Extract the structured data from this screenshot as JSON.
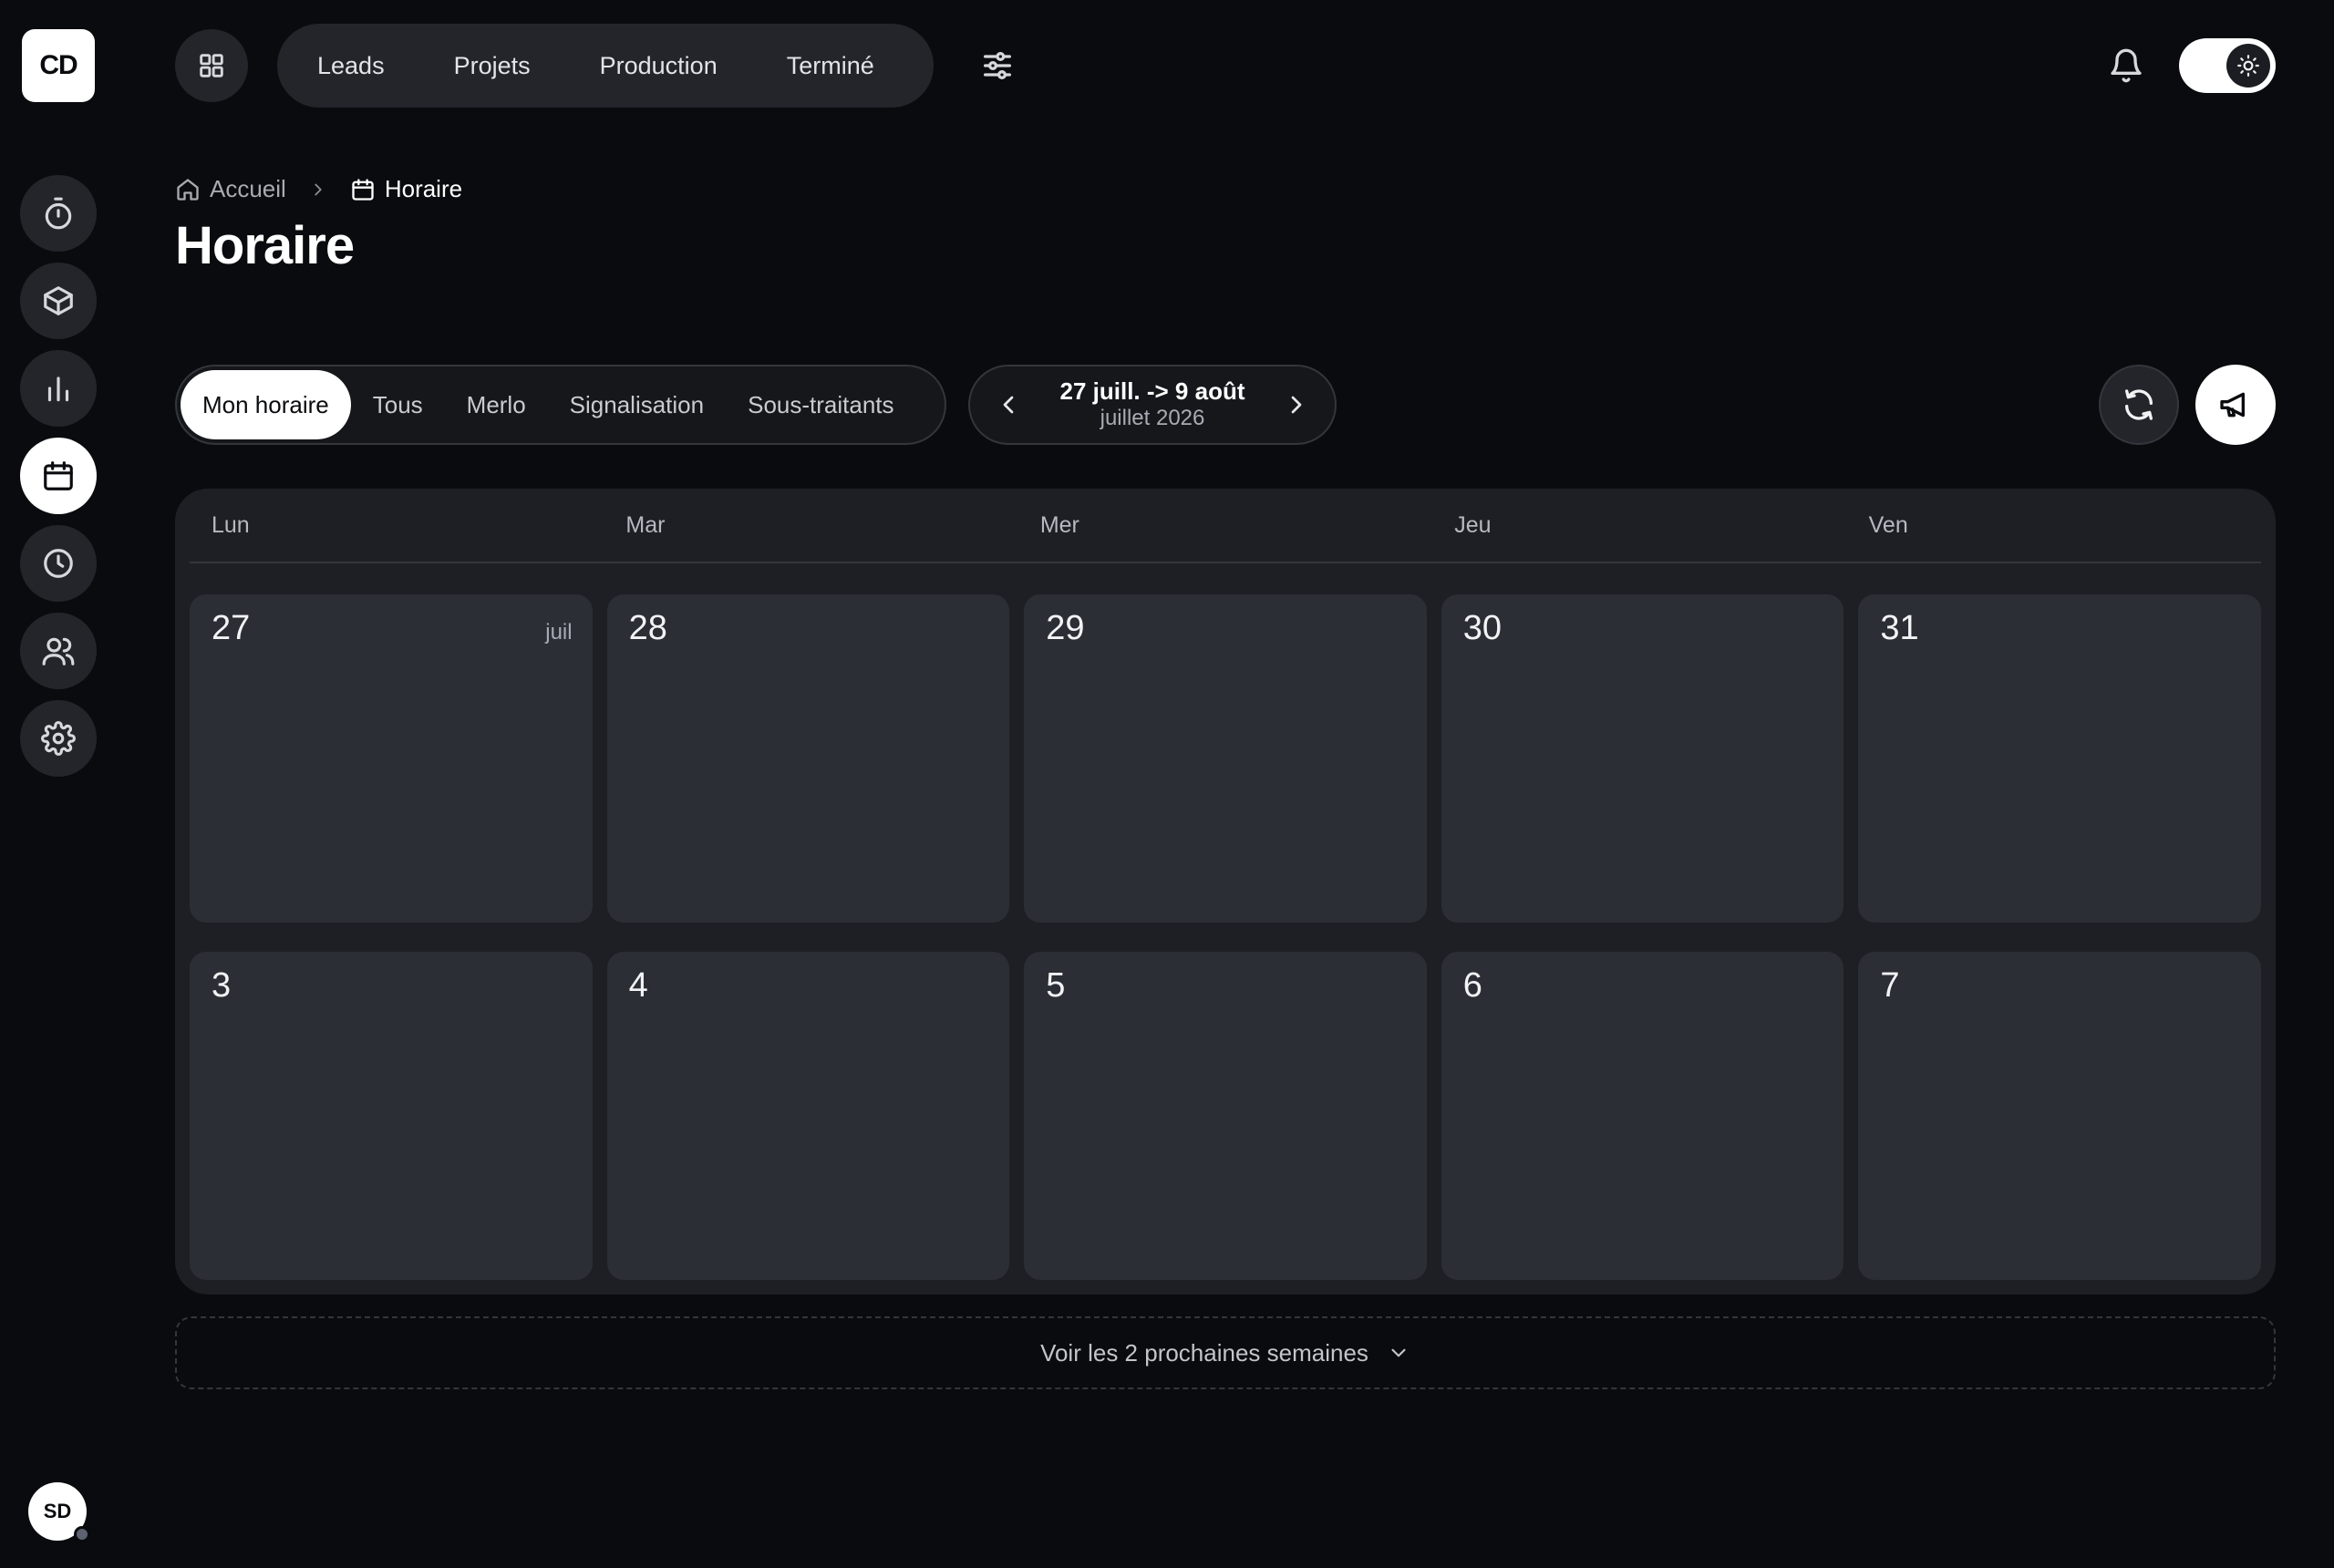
{
  "sidebar": {
    "logo": "CD",
    "items": [
      {
        "name": "timer-icon",
        "active": false
      },
      {
        "name": "box-icon",
        "active": false
      },
      {
        "name": "bar-chart-icon",
        "active": false
      },
      {
        "name": "calendar-icon",
        "active": true
      },
      {
        "name": "clock-icon",
        "active": false
      },
      {
        "name": "users-icon",
        "active": false
      },
      {
        "name": "gear-icon",
        "active": false
      }
    ],
    "user_initials": "SD"
  },
  "topbar": {
    "tabs": [
      "Leads",
      "Projets",
      "Production",
      "Terminé"
    ],
    "icons": [
      "grid-icon",
      "sliders-icon",
      "bell-icon",
      "sun-icon"
    ]
  },
  "breadcrumb": {
    "home": "Accueil",
    "current": "Horaire"
  },
  "page": {
    "title": "Horaire"
  },
  "filters": {
    "options": [
      "Mon horaire",
      "Tous",
      "Merlo",
      "Signalisation",
      "Sous-traitants"
    ],
    "selected": "Mon horaire"
  },
  "range": {
    "label": "27 juill. -> 9 août",
    "sublabel": "juillet 2026"
  },
  "calendar": {
    "weekdays": [
      "Lun",
      "Mar",
      "Mer",
      "Jeu",
      "Ven"
    ],
    "weeks": [
      [
        {
          "day": "27",
          "month": "juil"
        },
        {
          "day": "28"
        },
        {
          "day": "29"
        },
        {
          "day": "30"
        },
        {
          "day": "31"
        }
      ],
      [
        {
          "day": "3"
        },
        {
          "day": "4"
        },
        {
          "day": "5"
        },
        {
          "day": "6"
        },
        {
          "day": "7"
        }
      ]
    ]
  },
  "more_weeks_label": "Voir les 2 prochaines semaines",
  "colors": {
    "background": "#0a0b0e",
    "surface": "#23252b",
    "calendar_bg": "#1d1f24",
    "cell_bg": "#2b2e35",
    "accent": "#ffffff"
  }
}
